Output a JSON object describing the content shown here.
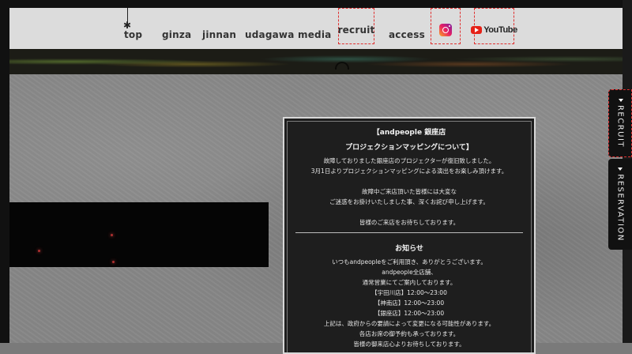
{
  "nav": {
    "items": [
      "top",
      "ginza",
      "jinnan",
      "udagawa",
      "media",
      "recruit",
      "access"
    ],
    "youtube_label": "YouTube"
  },
  "side_tabs": [
    "RECRUIT",
    "RESERVATION"
  ],
  "notice": {
    "title_1": "【andpeople 銀座店",
    "title_2": "プロジェクションマッピングについて】",
    "para_1": [
      "故障しておりました銀座店のプロジェクターが復旧致しました。",
      "3月1日よりプロジェクションマッピングによる演出をお楽しみ頂けます。"
    ],
    "para_2": [
      "故障中ご来店頂いた皆様には大変な",
      "ご迷惑をお掛けいたしました事、深くお詫び申し上げます。"
    ],
    "para_3": "皆様のご来店をお待ちしております。",
    "news_title": "お知らせ",
    "news_lines": [
      "いつもandpeopleをご利用頂き、ありがとうございます。",
      "andpeople全店舗、",
      "通常営業にてご案内しております。",
      "【宇田川店】12:00〜23:00",
      "【神南店】12:00〜23:00",
      "【銀座店】12:00〜23:00",
      "上記は、政府からの要請によって変更になる可能性があります。",
      "各店お席の御予約も承っております。",
      "皆様の御来店心よりお待ちしております。"
    ]
  }
}
